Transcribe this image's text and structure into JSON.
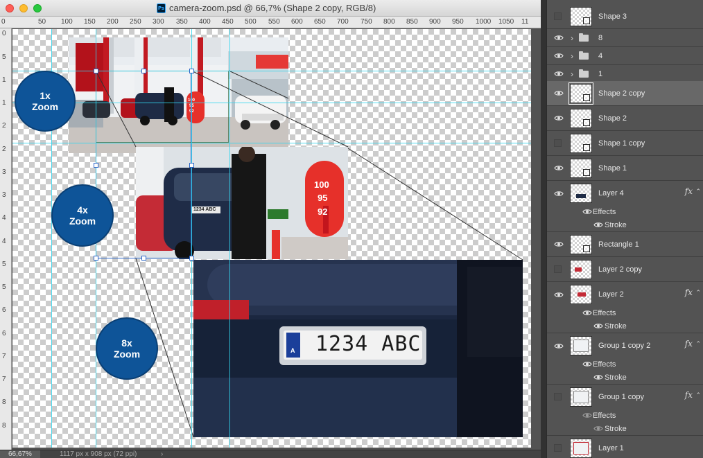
{
  "window": {
    "title": "camera-zoom.psd @ 66,7% (Shape 2 copy, RGB/8)",
    "app_badge": "Ps"
  },
  "ruler": {
    "top_ticks": [
      "0",
      "50",
      "100",
      "150",
      "200",
      "250",
      "300",
      "350",
      "400",
      "450",
      "500",
      "550",
      "600",
      "650",
      "700",
      "750",
      "800",
      "850",
      "900",
      "950",
      "1000",
      "1050",
      "11"
    ],
    "left_ticks": [
      "0",
      "5",
      "1",
      "1",
      "2",
      "2",
      "3",
      "3",
      "4",
      "4",
      "5",
      "5",
      "6",
      "6",
      "7",
      "7",
      "8",
      "8"
    ]
  },
  "canvas": {
    "zoom_circles": [
      {
        "line1": "1x",
        "line2": "Zoom"
      },
      {
        "line1": "4x",
        "line2": "Zoom"
      },
      {
        "line1": "8x",
        "line2": "Zoom"
      }
    ],
    "photo_1x": {
      "pump_numbers": [
        "100",
        "95",
        "92"
      ]
    },
    "photo_4x": {
      "pump_numbers": [
        "100",
        "95",
        "92"
      ],
      "plate": "1234 ABC"
    },
    "photo_8x": {
      "plate": "1234 ABC",
      "plate_country": "A"
    }
  },
  "statusbar": {
    "zoom": "66,67%",
    "doc_info": "1117 px x 908 px (72 ppi)",
    "arrow": "›"
  },
  "layers": {
    "effects_label": "Effects",
    "stroke_label": "Stroke",
    "fx_label": "fx",
    "items": [
      {
        "name": "Shape 3",
        "visible": false
      },
      {
        "name": "8",
        "visible": true,
        "type": "folder"
      },
      {
        "name": "4",
        "visible": true,
        "type": "folder"
      },
      {
        "name": "1",
        "visible": true,
        "type": "folder"
      },
      {
        "name": "Shape 2 copy",
        "visible": true,
        "selected": true
      },
      {
        "name": "Shape 2",
        "visible": true
      },
      {
        "name": "Shape 1 copy",
        "visible": false
      },
      {
        "name": "Shape 1",
        "visible": true
      },
      {
        "name": "Layer 4",
        "visible": true,
        "fx": true
      },
      {
        "name": "Rectangle 1",
        "visible": true
      },
      {
        "name": "Layer 2 copy",
        "visible": false
      },
      {
        "name": "Layer 2",
        "visible": true,
        "fx": true
      },
      {
        "name": "Group 1 copy 2",
        "visible": true,
        "fx": true
      },
      {
        "name": "Group 1 copy",
        "visible": false,
        "fx": true
      },
      {
        "name": "Layer 1",
        "visible": false
      }
    ]
  },
  "colors": {
    "guide": "#33d6ee",
    "circle": "#0e5498",
    "pump_red": "#e6302a"
  }
}
